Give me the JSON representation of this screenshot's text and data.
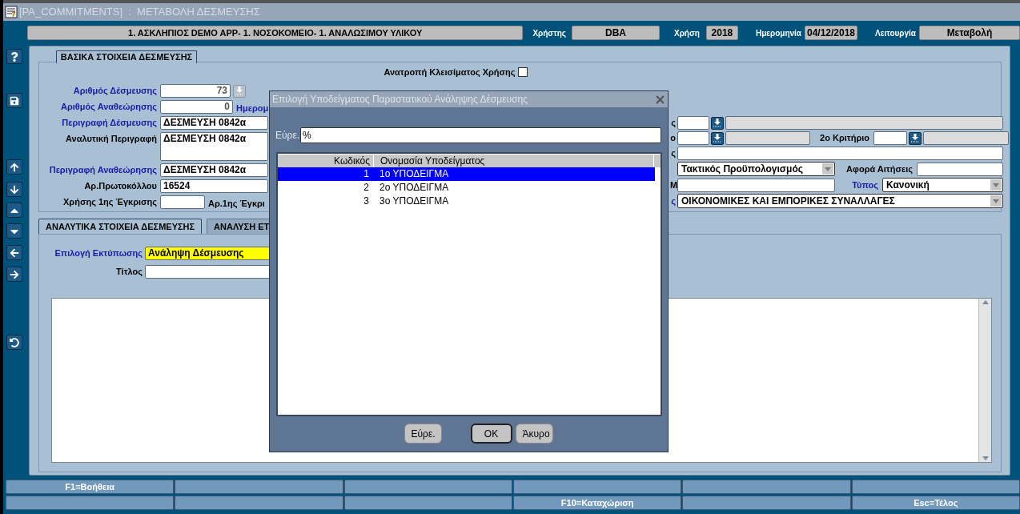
{
  "window": {
    "title": "[PA_COMMITMENTS]  :  ΜΕΤΑΒΟΛΗ ΔΕΣΜΕΥΣΗΣ"
  },
  "header": {
    "company": "1. ΑΣΚΛΗΠΙΟΣ DEMO APP- 1. ΝΟΣΟΚΟΜΕΙΟ- 1. ΑΝΑΛΩΣΙΜΟΥ ΥΛΙΚΟΥ",
    "fields": [
      {
        "label": "Χρήστης",
        "value": "DBA"
      },
      {
        "label": "Χρήση",
        "value": "2018"
      },
      {
        "label": "Ημερομηνία",
        "value": "04/12/2018"
      },
      {
        "label": "Λειτουργία",
        "value": "Μεταβολή"
      }
    ]
  },
  "basic_section": {
    "tab": "ΒΑΣΙΚΑ ΣΤΟΙΧΕΙΑ ΔΕΣΜΕΥΣΗΣ",
    "reversal": {
      "label": "Ανατροπή Κλεισίματος Χρήσης",
      "checked": false
    },
    "left_rows": [
      {
        "kind": "number_lov",
        "label": "Αριθμός Δέσμευσης",
        "color": "#1a1aa6",
        "value": "73",
        "button_disabled": true
      },
      {
        "kind": "number",
        "label": "Αριθμός Αναθεώρησης",
        "color": "#1a1aa6",
        "value": "0",
        "trailing": {
          "label": "Ημερομ",
          "color": "#1a1aa6"
        }
      },
      {
        "kind": "text",
        "label": "Περιγραφή Δέσμευσης",
        "color": "#1a1aa6",
        "value": "ΔΕΣΜΕΥΣΗ 0842α"
      },
      {
        "kind": "textarea",
        "label": "Αναλυτική Περιγραφή",
        "color": "#000000",
        "value": "ΔΕΣΜΕΥΣΗ 0842α"
      },
      {
        "kind": "text",
        "label": "Περιγραφή Αναθεώρησης",
        "color": "#1a1aa6",
        "value": "ΔΕΣΜΕΥΣΗ 0842α"
      },
      {
        "kind": "text",
        "label": "Αρ.Πρωτοκόλλου",
        "color": "#000000",
        "value": "16524"
      },
      {
        "kind": "short",
        "label": "Χρήσης 1ης Έγκρισης",
        "color": "#000000",
        "trailing": {
          "label": "Αρ.1ης Έγκρι",
          "color": "#000000"
        }
      }
    ],
    "right_rows": [
      {
        "kind": "lov",
        "label": "ς",
        "color": "#000000",
        "button_disabled": false
      },
      {
        "kind": "lov_pair",
        "label": "ο",
        "color": "#000000",
        "button_disabled": false,
        "second": {
          "label": "2ο Κριτήριο",
          "color": "#000000"
        }
      },
      {
        "kind": "text",
        "label": "ς",
        "color": "#000000"
      },
      {
        "kind": "select_text",
        "value": "Τακτικός Προϋπολογισμός",
        "second": {
          "label": "Αφορά Αιτήσεις",
          "color": "#000000"
        }
      },
      {
        "kind": "text_select",
        "label": "Μ",
        "color": "#000000",
        "second": {
          "label": "Τύπος",
          "color": "#1a1aa6"
        },
        "value": "Κανονική"
      },
      {
        "kind": "select",
        "label": "ς",
        "color": "#1a1aa6",
        "value": "ΟΙΚΟΝΟΜΙΚΕΣ ΚΑΙ ΕΜΠΟΡΙΚΕΣ ΣΥΝΑΛΛΑΓΕΣ"
      }
    ]
  },
  "tabs": [
    {
      "label": "ΑΝΑΛΥΤΙΚΑ ΣΤΟΙΧΕΙΑ ΔΕΣΜΕΥΣΗΣ",
      "selected": true
    },
    {
      "label": "ΑΝΑΛΥΣΗ ΕΤ",
      "selected": false
    }
  ],
  "detail": {
    "print_choice": {
      "label": "Επιλογή Εκτύπωσης",
      "color": "#1a1aa6",
      "value": "Ανάληψη Δέσμευσης"
    },
    "title_field": {
      "label": "Τίτλος"
    }
  },
  "dialog": {
    "title": "Επιλογή Υποδείγματος Παραστατικού Ανάληψης Δέσμευσης",
    "search": {
      "label": "Εύρε.",
      "value": "%"
    },
    "columns": [
      "Κωδικός",
      "Ονομασία Υποδείγματος"
    ],
    "rows": [
      {
        "code": "1",
        "name": "1ο ΥΠΟΔΕΙΓΜΑ",
        "selected": true
      },
      {
        "code": "2",
        "name": "2ο ΥΠΟΔΕΙΓΜΑ",
        "selected": false
      },
      {
        "code": "3",
        "name": "3ο ΥΠΟΔΕΙΓΜΑ",
        "selected": false
      }
    ],
    "buttons": [
      {
        "label": "Εύρε.",
        "default": false
      },
      {
        "label": "OK",
        "default": true
      },
      {
        "label": "Άκυρο",
        "default": false
      }
    ]
  },
  "function_keys": {
    "help": "F1=Βοήθεια",
    "commit": "F10=Καταχώριση",
    "exit": "Esc=Τέλος"
  }
}
